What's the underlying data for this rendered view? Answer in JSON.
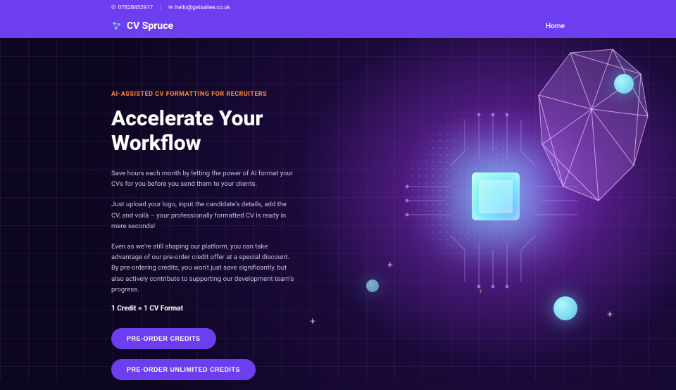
{
  "topbar": {
    "phone": "07828452917",
    "email": "hello@getsailee.co.uk"
  },
  "brand": "CV Spruce",
  "nav": {
    "home": "Home"
  },
  "hero": {
    "eyebrow": "AI-ASSISTED CV FORMATTING FOR RECRUITERS",
    "headline": "Accelerate Your Workflow",
    "p1": "Save hours each month by letting the power of AI format your CVs for you before you send them to your clients.",
    "p2": "Just upload your logo, input the candidate's details, add the CV, and voilà – your professionally formatted CV is ready in mere seconds!",
    "p3": "Even as we're still shaping our platform, you can take advantage of our pre-order credit offer at a special discount. By pre-ordering credits, you won't just save significantly, but also actively contribute to supporting our development team's progress.",
    "credit": "1 Credit = 1 CV Format",
    "btn1": "PRE-ORDER CREDITS",
    "btn2": "PRE-ORDER UNLIMITED CREDITS"
  }
}
